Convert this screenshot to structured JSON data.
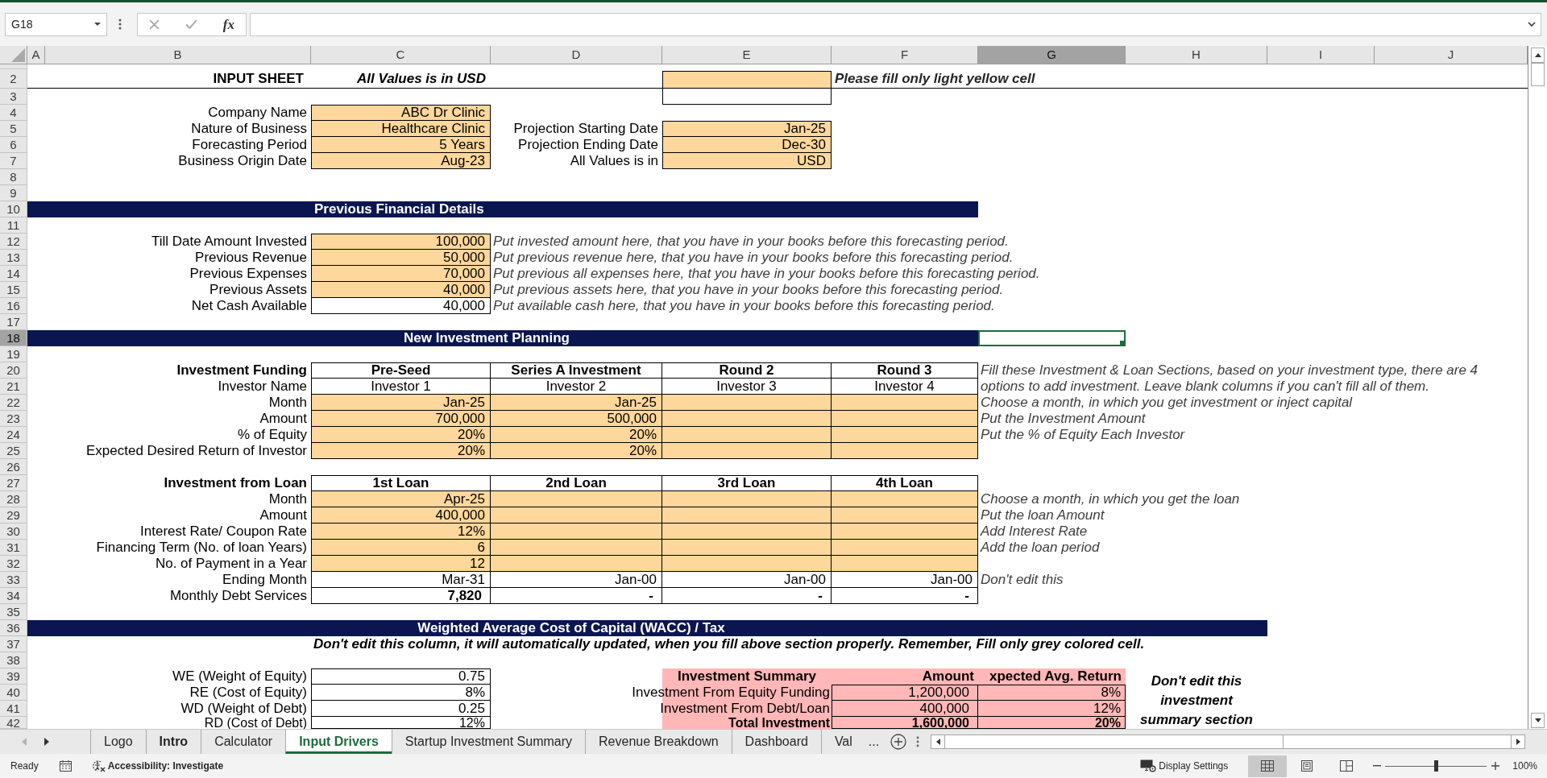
{
  "formula_bar": {
    "name_box": "G18",
    "edit_buttons": [
      {
        "kind": "cancel",
        "disabled": true
      },
      {
        "kind": "enter",
        "disabled": true
      }
    ],
    "function_label": "fx"
  },
  "column_headers": [
    {
      "label": "A",
      "selected": false
    },
    {
      "label": "B",
      "selected": false
    },
    {
      "label": "C",
      "selected": false
    },
    {
      "label": "D",
      "selected": false
    },
    {
      "label": "E",
      "selected": false
    },
    {
      "label": "F",
      "selected": false
    },
    {
      "label": "G",
      "selected": true
    },
    {
      "label": "H",
      "selected": false
    },
    {
      "label": "I",
      "selected": false
    },
    {
      "label": "J",
      "selected": false
    }
  ],
  "row_headers": [
    {
      "label": "2",
      "selected": false
    },
    {
      "label": "3",
      "selected": false
    },
    {
      "label": "4",
      "selected": false
    },
    {
      "label": "5",
      "selected": false
    },
    {
      "label": "6",
      "selected": false
    },
    {
      "label": "7",
      "selected": false
    },
    {
      "label": "8",
      "selected": false
    },
    {
      "label": "9",
      "selected": false
    },
    {
      "label": "10",
      "selected": false
    },
    {
      "label": "11",
      "selected": false
    },
    {
      "label": "12",
      "selected": false
    },
    {
      "label": "13",
      "selected": false
    },
    {
      "label": "14",
      "selected": false
    },
    {
      "label": "15",
      "selected": false
    },
    {
      "label": "16",
      "selected": false
    },
    {
      "label": "17",
      "selected": false
    },
    {
      "label": "18",
      "selected": true
    },
    {
      "label": "19",
      "selected": false
    },
    {
      "label": "20",
      "selected": false
    },
    {
      "label": "21",
      "selected": false
    },
    {
      "label": "22",
      "selected": false
    },
    {
      "label": "23",
      "selected": false
    },
    {
      "label": "24",
      "selected": false
    },
    {
      "label": "25",
      "selected": false
    },
    {
      "label": "26",
      "selected": false
    },
    {
      "label": "27",
      "selected": false
    },
    {
      "label": "28",
      "selected": false
    },
    {
      "label": "29",
      "selected": false
    },
    {
      "label": "30",
      "selected": false
    },
    {
      "label": "31",
      "selected": false
    },
    {
      "label": "32",
      "selected": false
    },
    {
      "label": "33",
      "selected": false
    },
    {
      "label": "34",
      "selected": false
    },
    {
      "label": "35",
      "selected": false
    },
    {
      "label": "36",
      "selected": false
    },
    {
      "label": "37",
      "selected": false
    },
    {
      "label": "38",
      "selected": false
    },
    {
      "label": "39",
      "selected": false
    },
    {
      "label": "40",
      "selected": false
    },
    {
      "label": "41",
      "selected": false
    },
    {
      "label": "42",
      "selected": false
    }
  ],
  "sheet_header": {
    "title": "INPUT SHEET",
    "currency_note": "All Values is in USD",
    "legend_note": "Please fill only light yellow cell"
  },
  "company_details": [
    {
      "label": "Company Name",
      "value": "ABC Dr Clinic",
      "kind": "input"
    },
    {
      "label": "Nature of Business",
      "value": "Healthcare Clinic",
      "kind": "input"
    },
    {
      "label": "Forecasting Period",
      "value": "5 Years",
      "kind": "input"
    },
    {
      "label": "Business Origin Date",
      "value": "Aug-23",
      "kind": "input"
    }
  ],
  "projection_details": [
    {
      "label": "Projection Starting Date",
      "value": "Jan-25",
      "kind": "input"
    },
    {
      "label": "Projection Ending Date",
      "value": "Dec-30",
      "kind": "input"
    },
    {
      "label": "All Values is in",
      "value": "USD",
      "kind": "input"
    }
  ],
  "previous_financials": {
    "title": "Previous Financial Details",
    "rows": [
      {
        "label": "Till Date Amount Invested",
        "value": "100,000",
        "kind": "input",
        "note": "Put invested amount here, that you have in your books before this forecasting period."
      },
      {
        "label": "Previous Revenue",
        "value": "50,000",
        "kind": "input",
        "note": "Put previous revenue here, that you have in your books before this forecasting period."
      },
      {
        "label": "Previous Expenses",
        "value": "70,000",
        "kind": "input",
        "note": "Put previous all expenses here, that you have in your books before this forecasting period."
      },
      {
        "label": "Previous Assets",
        "value": "40,000",
        "kind": "input",
        "note": "Put previous assets here, that you have in your books before this forecasting period."
      },
      {
        "label": "Net Cash Available",
        "value": "40,000",
        "kind": "calculated",
        "note": "Put available cash here, that you have in your books before this forecasting period."
      }
    ]
  },
  "investment_funding": {
    "section_title": "New Investment Planning",
    "intro_note": "Fill these Investment & Loan Sections, based on your investment type, there are 4 options to add investment. Leave blank columns if you can't fill all of them.",
    "header": "Investment Funding",
    "columns": [
      "Pre-Seed",
      "Series A Investment",
      "Round 2",
      "Round 3"
    ],
    "rows": [
      {
        "label": "Investor Name",
        "kind": "names",
        "cells": [
          "Investor 1",
          "Investor 2",
          "Investor 3",
          "Investor 4"
        ]
      },
      {
        "label": "Month",
        "kind": "input",
        "cells": [
          "Jan-25",
          "Jan-25"
        ],
        "note": "Choose a month, in which you get investment or inject capital"
      },
      {
        "label": "Amount",
        "kind": "input",
        "cells": [
          "700,000",
          "500,000"
        ],
        "note": "Put the Investment Amount"
      },
      {
        "label": "% of Equity",
        "kind": "input",
        "cells": [
          "20%",
          "20%"
        ],
        "note": "Put the % of Equity Each Investor"
      },
      {
        "label": "Expected Desired Return of Investor",
        "kind": "input",
        "cells": [
          "20%",
          "20%"
        ]
      }
    ]
  },
  "loan_funding": {
    "header": "Investment from Loan",
    "columns": [
      "1st Loan",
      "2nd Loan",
      "3rd Loan",
      "4th Loan"
    ],
    "rows": [
      {
        "label": "Month",
        "kind": "input",
        "cells": [
          "Apr-25"
        ],
        "note": "Choose a month, in which you get the loan"
      },
      {
        "label": "Amount",
        "kind": "input",
        "cells": [
          "400,000"
        ],
        "note": "Put the loan Amount"
      },
      {
        "label": "Interest Rate/ Coupon Rate",
        "kind": "input",
        "cells": [
          "12%"
        ],
        "note": "Add Interest Rate"
      },
      {
        "label": "Financing Term (No. of loan Years)",
        "kind": "input",
        "cells": [
          "6"
        ],
        "note": "Add the loan period"
      },
      {
        "label": "No. of Payment in a Year",
        "kind": "input",
        "cells": [
          "12"
        ]
      },
      {
        "label": "Ending Month",
        "kind": "calculated",
        "cells": [
          "Mar-31",
          "Jan-00",
          "Jan-00",
          "Jan-00"
        ],
        "note": "Don't edit this"
      },
      {
        "label": "Monthly Debt Services",
        "kind": "total",
        "cells": [
          "7,820",
          "-",
          "-",
          "-"
        ]
      }
    ]
  },
  "wacc": {
    "section_title": "Weighted Average Cost of Capital (WACC) / Tax",
    "instruction": "Don't edit this column, it will automatically updated, when you fill above section properly. Remember, Fill only grey colored cell.",
    "rows": [
      {
        "label": "WE (Weight of Equity)",
        "value": "0.75"
      },
      {
        "label": "RE (Cost of Equity)",
        "value": "8%"
      },
      {
        "label": "WD (Weight of Debt)",
        "value": "0.25"
      },
      {
        "label": "RD (Cost of Debt)",
        "value": "12%"
      }
    ]
  },
  "investment_summary": {
    "columns": [
      "Investment Summary",
      "Amount",
      "xpected Avg. Return"
    ],
    "rows": [
      {
        "label": "Investment From Equity Funding",
        "amount": "1,200,000",
        "expected_return": "8%",
        "kind": "item"
      },
      {
        "label": "Investment From Debt/Loan",
        "amount": "400,000",
        "expected_return": "12%",
        "kind": "item"
      },
      {
        "label": "Total Investment",
        "amount": "1,600,000",
        "expected_return": "20%",
        "kind": "total"
      }
    ],
    "note": "Don't edit this investment summary section"
  },
  "sheet_tabs": {
    "nav": [
      {
        "kind": "previous",
        "disabled": true
      },
      {
        "kind": "next",
        "disabled": false
      }
    ],
    "tabs": [
      {
        "label": "Logo",
        "selected": false,
        "bold": false
      },
      {
        "label": "Intro",
        "selected": false,
        "bold": true
      },
      {
        "label": "Calculator",
        "selected": false,
        "bold": false
      },
      {
        "label": "Input Drivers",
        "selected": true,
        "bold": true
      },
      {
        "label": "Startup Investment Summary",
        "selected": false,
        "bold": false
      },
      {
        "label": "Revenue Breakdown",
        "selected": false,
        "bold": false
      },
      {
        "label": "Dashboard",
        "selected": false,
        "bold": false
      },
      {
        "label": "Val",
        "selected": false,
        "bold": false
      }
    ],
    "more_label": "..."
  },
  "status_bar": {
    "mode": "Ready",
    "accessibility": "Accessibility: Investigate",
    "display_settings": "Display Settings",
    "view_buttons": [
      {
        "kind": "normal",
        "selected": true
      },
      {
        "kind": "page_layout",
        "selected": false
      },
      {
        "kind": "page_break_preview",
        "selected": false
      }
    ],
    "zoom": {
      "level": 0.5,
      "reading": "100%"
    }
  }
}
